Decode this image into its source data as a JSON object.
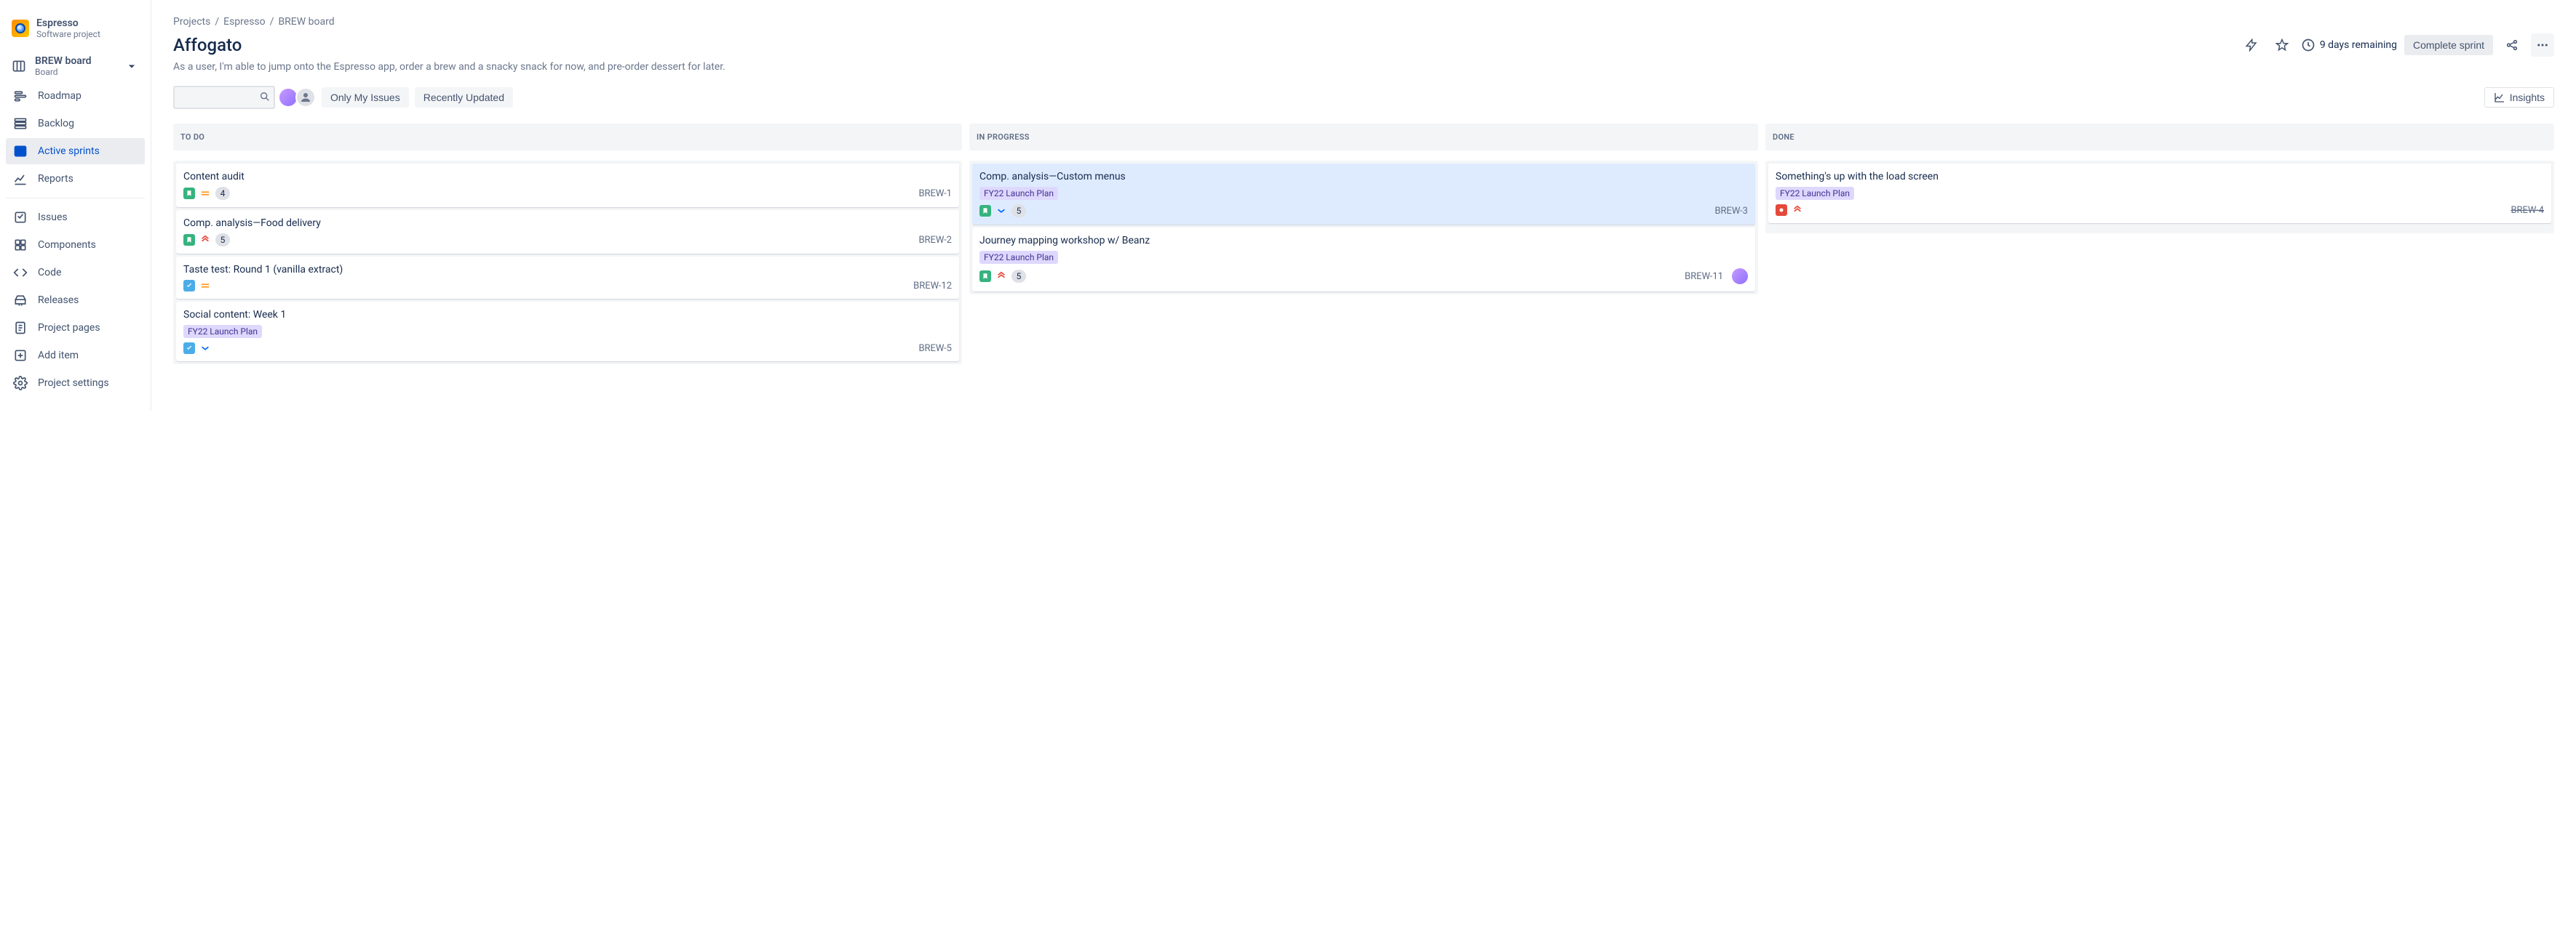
{
  "project": {
    "name": "Espresso",
    "type": "Software project"
  },
  "boardSelector": {
    "name": "BREW board",
    "sub": "Board"
  },
  "nav": [
    {
      "id": "roadmap",
      "label": "Roadmap",
      "icon": "roadmap"
    },
    {
      "id": "backlog",
      "label": "Backlog",
      "icon": "backlog"
    },
    {
      "id": "active",
      "label": "Active sprints",
      "icon": "board",
      "active": true
    },
    {
      "id": "reports",
      "label": "Reports",
      "icon": "reports"
    }
  ],
  "navLower": [
    {
      "id": "issues",
      "label": "Issues",
      "icon": "issues"
    },
    {
      "id": "components",
      "label": "Components",
      "icon": "components"
    },
    {
      "id": "code",
      "label": "Code",
      "icon": "code"
    },
    {
      "id": "releases",
      "label": "Releases",
      "icon": "releases"
    },
    {
      "id": "pages",
      "label": "Project pages",
      "icon": "pages"
    },
    {
      "id": "additem",
      "label": "Add item",
      "icon": "add"
    },
    {
      "id": "settings",
      "label": "Project settings",
      "icon": "settings"
    }
  ],
  "breadcrumb": {
    "root": "Projects",
    "project": "Espresso",
    "board": "BREW board"
  },
  "sprint": {
    "name": "Affogato",
    "goal": "As a user, I'm able to jump onto the Espresso app, order a brew and a snacky snack for now, and pre-order dessert for later.",
    "remaining": "9 days remaining",
    "completeLabel": "Complete sprint"
  },
  "filters": {
    "onlyMy": "Only My Issues",
    "recent": "Recently Updated",
    "insights": "Insights"
  },
  "columns": [
    {
      "id": "todo",
      "title": "TO DO"
    },
    {
      "id": "inprogress",
      "title": "IN PROGRESS"
    },
    {
      "id": "done",
      "title": "DONE"
    }
  ],
  "cards": {
    "todo": [
      {
        "title": "Content audit",
        "type": "story",
        "priority": "medium",
        "points": "4",
        "key": "BREW-1"
      },
      {
        "title": "Comp. analysis—Food delivery",
        "type": "story",
        "priority": "high",
        "points": "5",
        "key": "BREW-2"
      },
      {
        "title": "Taste test: Round 1 (vanilla extract)",
        "type": "task",
        "priority": "medium",
        "key": "BREW-12"
      },
      {
        "title": "Social content: Week 1",
        "epic": "FY22 Launch Plan",
        "type": "task",
        "priority": "low",
        "key": "BREW-5"
      }
    ],
    "inprogress": [
      {
        "title": "Comp. analysis—Custom menus",
        "epic": "FY22 Launch Plan",
        "type": "story",
        "priority": "low",
        "points": "5",
        "key": "BREW-3",
        "selected": true
      },
      {
        "title": "Journey mapping workshop w/ Beanz",
        "epic": "FY22 Launch Plan",
        "type": "story",
        "priority": "high",
        "points": "5",
        "key": "BREW-11",
        "assignee": true
      }
    ],
    "done": [
      {
        "title": "Something's up with the load screen",
        "epic": "FY22 Launch Plan",
        "type": "bug",
        "priority": "high",
        "key": "BREW-4",
        "done": true
      }
    ]
  }
}
